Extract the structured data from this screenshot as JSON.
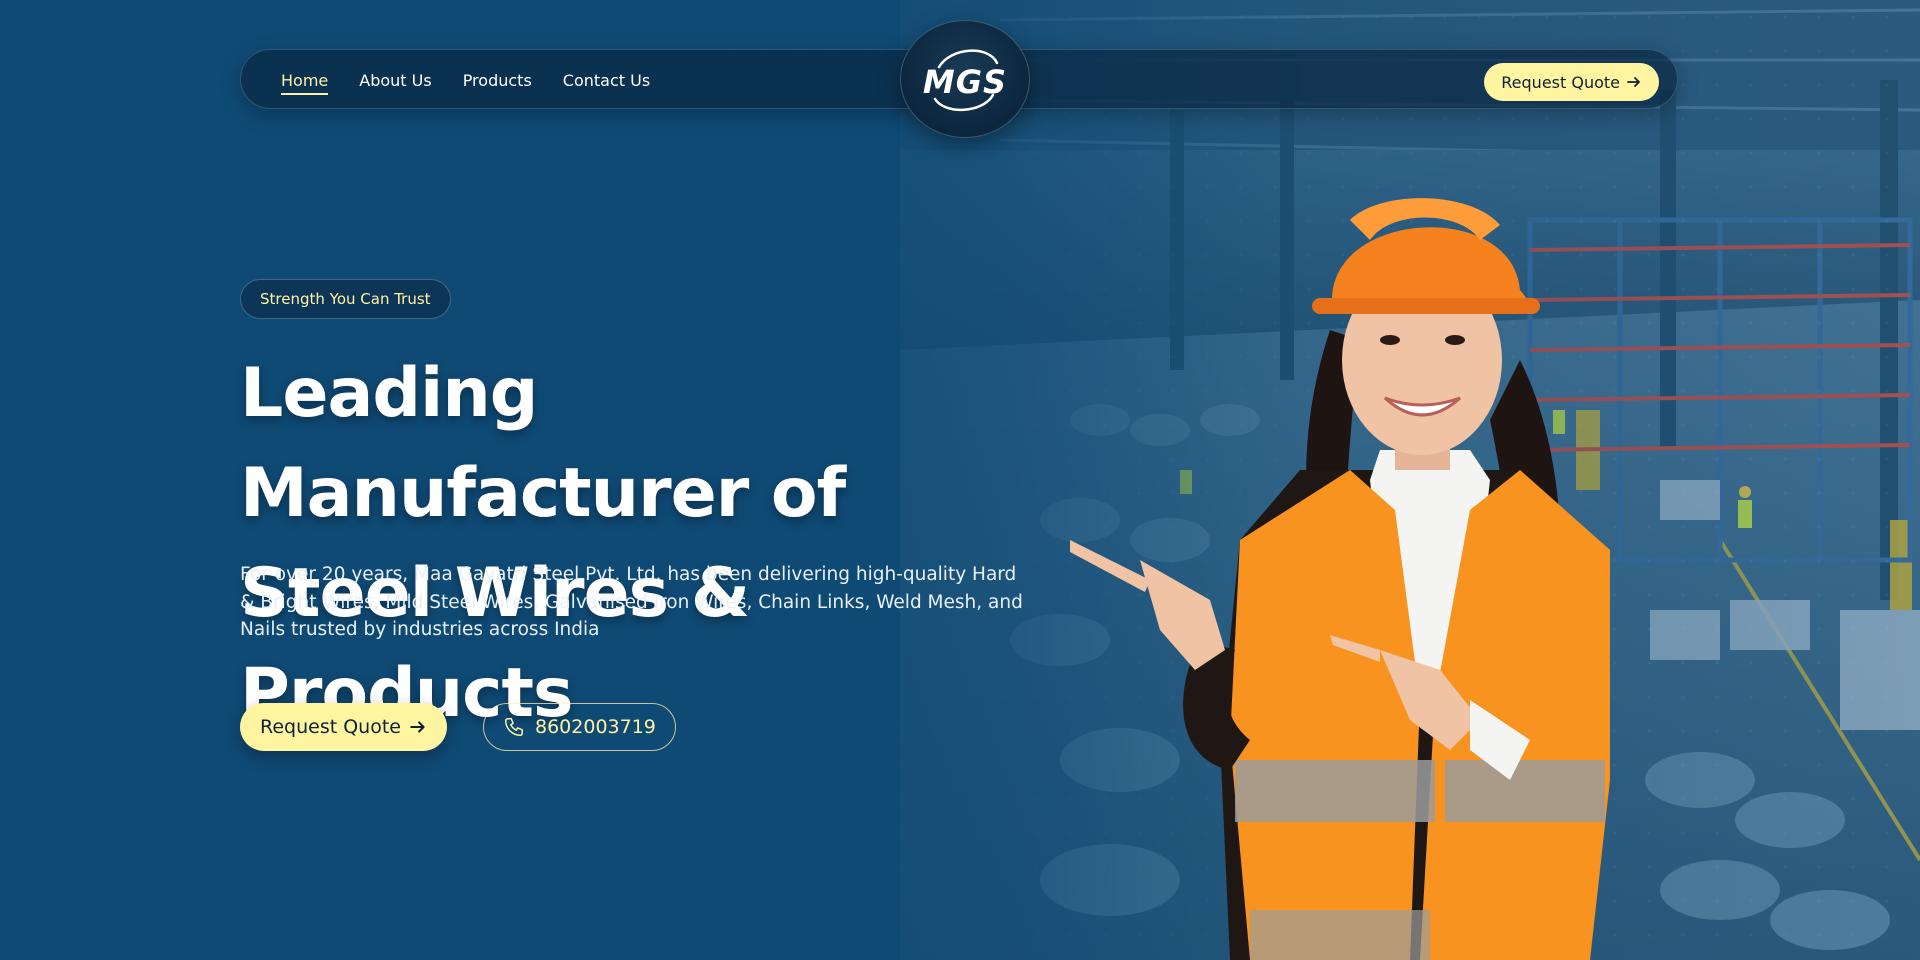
{
  "nav": {
    "links": [
      {
        "label": "Home",
        "active": true
      },
      {
        "label": "About Us",
        "active": false
      },
      {
        "label": "Products",
        "active": false
      },
      {
        "label": "Contact Us",
        "active": false
      }
    ],
    "cta_label": "Request Quote",
    "cta_icon": "arrow-right-icon"
  },
  "logo": {
    "text": "MGS"
  },
  "hero": {
    "badge": "Strength You Can Trust",
    "headline_line1": "Leading Manufacturer of",
    "headline_line2": "Steel Wires & Products",
    "description": "For over 20 years, Maa Gayatri Steel Pvt. Ltd. has been delivering high-quality Hard & Bright Wires, Mild Steel Wires, Galvanised Iron Wires, Chain Links, Weld Mesh, and Nails trusted by industries across India",
    "primary_button": "Request Quote",
    "phone_number": "8602003719"
  },
  "colors": {
    "background": "#0f4a75",
    "accent": "#fff5a0",
    "nav_bg": "#0a2842",
    "vest": "#f7931e",
    "helmet": "#f5821f"
  }
}
